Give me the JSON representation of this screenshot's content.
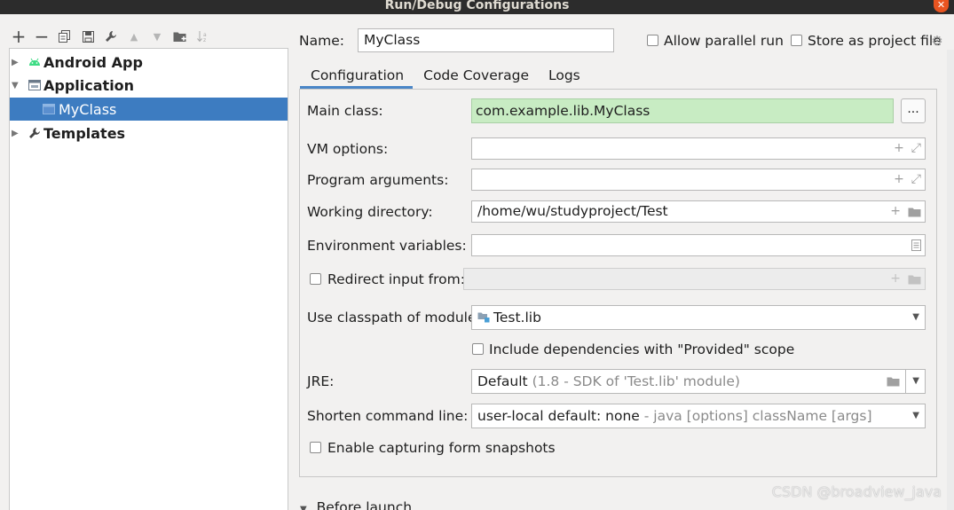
{
  "window": {
    "title": "Run/Debug Configurations"
  },
  "toolbar": {
    "buttons": [
      {
        "name": "add-icon",
        "glyph": "+"
      },
      {
        "name": "remove-icon",
        "glyph": "−"
      },
      {
        "name": "copy-icon",
        "glyph": "copy"
      },
      {
        "name": "save-icon",
        "glyph": "save"
      },
      {
        "name": "wrench-icon",
        "glyph": "wrench"
      },
      {
        "name": "move-up-icon",
        "glyph": "▲"
      },
      {
        "name": "move-down-icon",
        "glyph": "▼"
      },
      {
        "name": "folder-add-icon",
        "glyph": "folder"
      },
      {
        "name": "sort-icon",
        "glyph": "sort"
      }
    ]
  },
  "tree": {
    "items": [
      {
        "label": "Android App",
        "icon": "android-icon"
      },
      {
        "label": "Application",
        "icon": "application-icon"
      },
      {
        "label": "MyClass",
        "icon": "class-config-icon"
      },
      {
        "label": "Templates",
        "icon": "wrench-icon"
      }
    ]
  },
  "header": {
    "name_label": "Name:",
    "name_value": "MyClass",
    "allow_parallel_label": "Allow parallel run",
    "store_as_file_label": "Store as project file"
  },
  "tabs": [
    "Configuration",
    "Code Coverage",
    "Logs"
  ],
  "form": {
    "main_class_label": "Main class:",
    "main_class_value": "com.example.lib.MyClass",
    "main_class_browse": "...",
    "vm_options_label": "VM options:",
    "vm_options_value": "",
    "program_args_label": "Program arguments:",
    "program_args_value": "",
    "working_dir_label": "Working directory:",
    "working_dir_value": "/home/wu/studyproject/Test",
    "env_vars_label": "Environment variables:",
    "env_vars_value": "",
    "redirect_label": "Redirect input from:",
    "classpath_label": "Use classpath of module:",
    "classpath_value": "Test.lib",
    "include_deps_label": "Include dependencies with \"Provided\" scope",
    "jre_label": "JRE:",
    "jre_value": "Default",
    "jre_hint": "(1.8 - SDK of 'Test.lib' module)",
    "shorten_label": "Shorten command line:",
    "shorten_value": "user-local default: none",
    "shorten_hint": "- java [options] className [args]",
    "snapshots_label": "Enable capturing form snapshots"
  },
  "before_launch": {
    "label": "Before launch"
  },
  "watermark": "CSDN @broadview_java",
  "colors": {
    "selection": "#3d7cc1",
    "main_class_bg": "#c8ecc3",
    "tab_underline": "#4a86c7"
  }
}
